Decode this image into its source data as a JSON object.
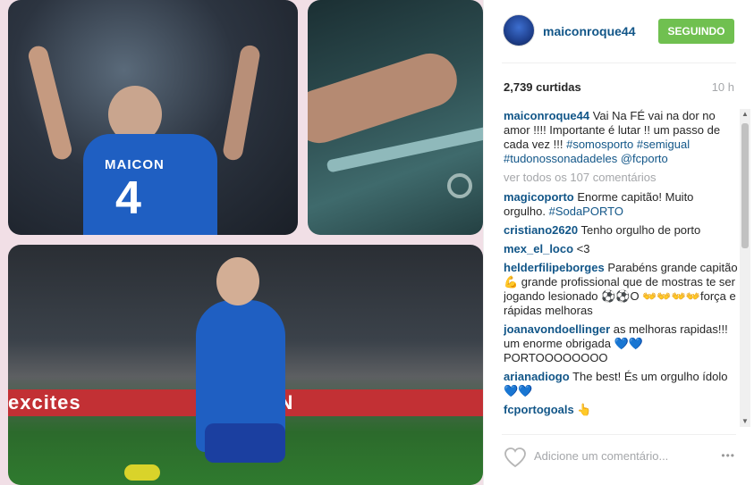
{
  "post": {
    "username": "maiconroque44",
    "follow_label": "SEGUINDO",
    "likes": "2,739 curtidas",
    "time": "10 h",
    "photo1": {
      "name_text": "MAICON",
      "number_text": "4"
    },
    "photo3": {
      "banner_left": "excites",
      "banner_right": "SAN"
    }
  },
  "caption": {
    "user": "maiconroque44",
    "text": " Vai Na FÉ vai na dor no amor !!!! Importante é lutar !! um passo de cada vez !!! ",
    "tags": "#somosporto #semigual #tudonossonadadeles @fcporto"
  },
  "view_all": "ver todos os 107 comentários",
  "comments": [
    {
      "user": "magicoporto",
      "text": " Enorme capitão! Muito orgulho. ",
      "tag": "#SodaPORTO"
    },
    {
      "user": "cristiano2620",
      "text": " Tenho orgulho de porto",
      "tag": ""
    },
    {
      "user": "mex_el_loco",
      "text": " <3",
      "tag": ""
    },
    {
      "user": "helderfilipeborges",
      "text": " Parabéns grande capitão 💪 grande profissional que de mostras te ser jogando lesionado ⚽⚽O 👐👐👐👐força e rápidas melhoras",
      "tag": ""
    },
    {
      "user": "joanavondoellinger",
      "text": " as melhoras rapidas!!! um enorme obrigada 💙💙 PORTOOOOOOOO",
      "tag": ""
    },
    {
      "user": "arianadiogo",
      "text": " The best! És um orgulho ídolo 💙💙",
      "tag": ""
    },
    {
      "user": "fcportogoals",
      "text": " 👆",
      "tag": ""
    }
  ],
  "footer": {
    "add_comment_placeholder": "Adicione um comentário...",
    "more_label": "•••"
  },
  "icons": {
    "heart": "heart-icon",
    "scroll_up": "chevron-up-icon",
    "scroll_down": "chevron-down-icon"
  },
  "colors": {
    "follow_button": "#70c050",
    "link": "#125688",
    "muted": "#a5a7aa"
  }
}
